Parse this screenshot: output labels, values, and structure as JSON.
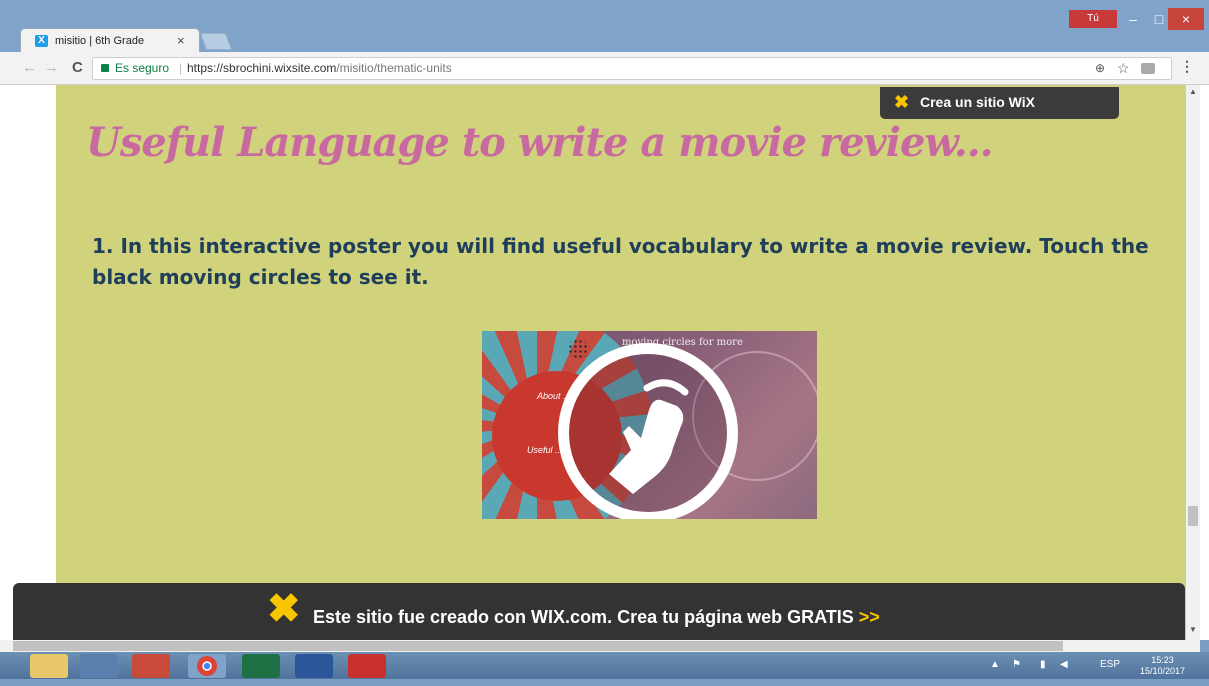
{
  "browser": {
    "tab_title": "misitio | 6th Grade",
    "tab_favicon_letter": "X",
    "tab_close": "×",
    "window_user_label": "Tú",
    "window_minimize": "–",
    "window_maximize": "□",
    "window_close": "×",
    "secure_label": "Es seguro",
    "separator": "|",
    "url_host": "https://sbrochini.wixsite.com",
    "url_path": "/misitio/thematic-units",
    "nav_back": "←",
    "nav_forward": "→",
    "nav_reload": "C",
    "zoom_icon": "⊕",
    "star_icon": "☆",
    "menu_icon": "⋮"
  },
  "page": {
    "wix_badge_label": "Crea un sitio WiX",
    "heading": "Useful Language to write a movie review...",
    "instruction": "1. In this interactive poster you will find useful vocabulary to write a movie review. Touch the black moving circles to see it.",
    "poster_text_top": "moving circles for more",
    "poster_text_1": "About ...",
    "poster_text_2": "Useful ...",
    "footer_prefix": "Este sitio fue creado con WIX.com. Crea tu página web GRATIS",
    "footer_arrow": ">>"
  },
  "taskbar": {
    "language": "ESP",
    "time": "15:23",
    "date": "15/10/2017"
  },
  "colors": {
    "page_background": "#d1d27c",
    "heading": "#c86aa0",
    "instruction": "#1f3e5a",
    "wix_yellow": "#f7c600",
    "footer_bar": "#333333"
  }
}
